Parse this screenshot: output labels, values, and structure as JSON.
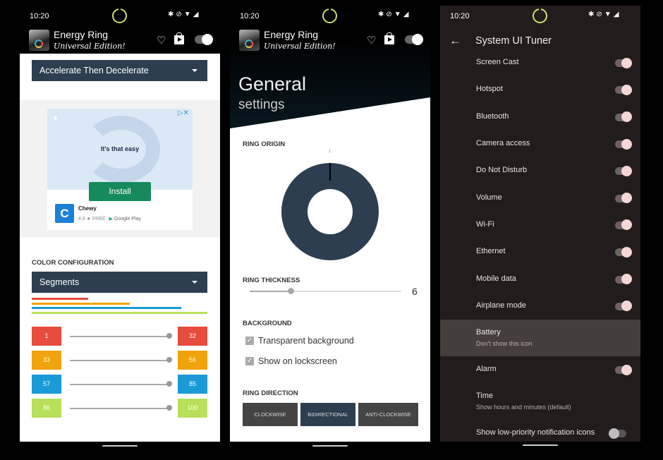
{
  "status_bar": {
    "time": "10:20",
    "icons": [
      "bluetooth-icon",
      "mute-icon",
      "wifi-icon",
      "signal-icon"
    ]
  },
  "app": {
    "title": "Energy Ring",
    "subtitle": "Universal Edition!"
  },
  "panel1": {
    "animation_dropdown": "Accelerate Then Decelerate",
    "ad": {
      "headline": "It's that easy",
      "install_label": "Install",
      "advertiser": "Chewy",
      "advertiser_initial": "C",
      "rating": "4.8 ★ FREE",
      "store": "Google Play"
    },
    "color_config_label": "COLOR CONFIGURATION",
    "color_mode_dropdown": "Segments",
    "color_bars": [
      {
        "color": "#e74c3c",
        "fraction": 0.32
      },
      {
        "color": "#f0a30a",
        "fraction": 0.56
      },
      {
        "color": "#1a9ad6",
        "fraction": 0.85
      },
      {
        "color": "#b8e05a",
        "fraction": 1.0
      }
    ],
    "segments": [
      {
        "start": "1",
        "end": "32",
        "color": "#e74c3c"
      },
      {
        "start": "33",
        "end": "56",
        "color": "#f0a30a"
      },
      {
        "start": "57",
        "end": "85",
        "color": "#1a9ad6"
      },
      {
        "start": "86",
        "end": "100",
        "color": "#b8e05a"
      }
    ]
  },
  "panel2": {
    "heading": "General",
    "subheading": "settings",
    "ring_origin_label": "RING ORIGIN",
    "ring_origin_value": "1",
    "ring_thickness_label": "RING THICKNESS",
    "ring_thickness_value": "6",
    "ring_thickness_fraction": 0.27,
    "background_label": "BACKGROUND",
    "checkboxes": [
      {
        "label": "Transparent background",
        "checked": true
      },
      {
        "label": "Show on lockscreen",
        "checked": true
      }
    ],
    "ring_direction_label": "RING DIRECTION",
    "directions": [
      {
        "label": "CLOCKWISE",
        "selected": false
      },
      {
        "label": "BIDIRECTIONAL",
        "selected": true
      },
      {
        "label": "ANTI-CLOCKWISE",
        "selected": false
      }
    ],
    "accent_color": "#2c3e50"
  },
  "panel3": {
    "title": "System UI Tuner",
    "items": [
      {
        "label": "Screen Cast",
        "toggle": true,
        "on": true
      },
      {
        "label": "Hotspot",
        "toggle": true,
        "on": true
      },
      {
        "label": "Bluetooth",
        "toggle": true,
        "on": true
      },
      {
        "label": "Camera access",
        "toggle": true,
        "on": true
      },
      {
        "label": "Do Not Disturb",
        "toggle": true,
        "on": true
      },
      {
        "label": "Volume",
        "toggle": true,
        "on": true
      },
      {
        "label": "Wi-Fi",
        "toggle": true,
        "on": true
      },
      {
        "label": "Ethernet",
        "toggle": true,
        "on": true
      },
      {
        "label": "Mobile data",
        "toggle": true,
        "on": true
      },
      {
        "label": "Airplane mode",
        "toggle": true,
        "on": true
      },
      {
        "label": "Battery",
        "sub": "Don't show this icon",
        "toggle": false,
        "highlighted": true
      },
      {
        "label": "Alarm",
        "toggle": true,
        "on": true
      },
      {
        "label": "Time",
        "sub": "Show hours and minutes (default)",
        "toggle": false
      },
      {
        "label": "Show low-priority notification icons",
        "toggle": true,
        "on": false
      }
    ]
  }
}
